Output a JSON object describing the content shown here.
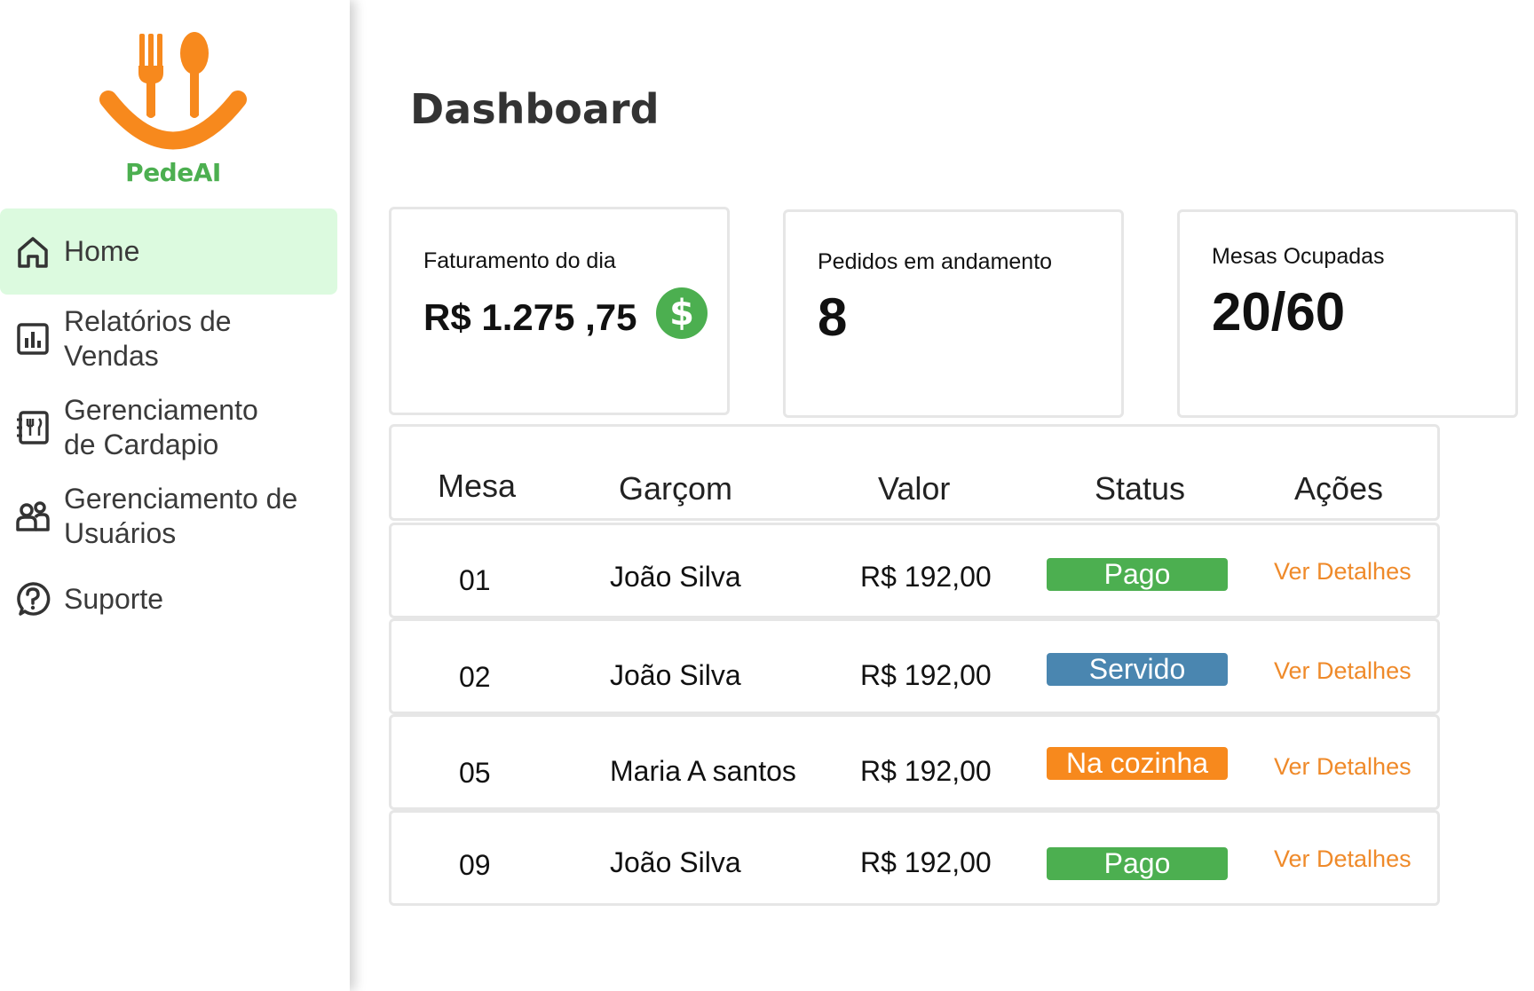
{
  "brand": {
    "name": "PedeAI",
    "orange": "#f7891d",
    "green": "#4caf50"
  },
  "sidebar": {
    "items": [
      {
        "label": "Home",
        "icon": "home-icon",
        "active": true
      },
      {
        "label": "Relatórios de Vendas",
        "icon": "bar-chart-icon",
        "active": false
      },
      {
        "label": "Gerenciamento de Cardapio",
        "icon": "menu-book-icon",
        "active": false
      },
      {
        "label": "Gerenciamento de Usuários",
        "icon": "users-icon",
        "active": false
      },
      {
        "label": "Suporte",
        "icon": "help-icon",
        "active": false
      }
    ]
  },
  "page": {
    "title": "Dashboard"
  },
  "cards": [
    {
      "label": "Faturamento do dia",
      "value": "R$ 1.275 ,75",
      "icon": "dollar-icon"
    },
    {
      "label": "Pedidos em andamento",
      "value": "8"
    },
    {
      "label": "Mesas Ocupadas",
      "value": "20/60"
    }
  ],
  "table": {
    "headers": {
      "mesa": "Mesa",
      "garcom": "Garçom",
      "valor": "Valor",
      "status": "Status",
      "acoes": "Ações"
    },
    "rows": [
      {
        "mesa": "01",
        "garcom": "João Silva",
        "valor": "R$ 192,00",
        "status": "Pago",
        "status_color": "#4caf50",
        "action": "Ver Detalhes"
      },
      {
        "mesa": "02",
        "garcom": "João Silva",
        "valor": "R$ 192,00",
        "status": "Servido",
        "status_color": "#4a86b0",
        "action": "Ver Detalhes"
      },
      {
        "mesa": "05",
        "garcom": "Maria A santos",
        "valor": "R$ 192,00",
        "status": "Na cozinha",
        "status_color": "#f7891d",
        "action": "Ver Detalhes"
      },
      {
        "mesa": "09",
        "garcom": "João Silva",
        "valor": "R$ 192,00",
        "status": "Pago",
        "status_color": "#4caf50",
        "action": "Ver Detalhes"
      }
    ]
  }
}
